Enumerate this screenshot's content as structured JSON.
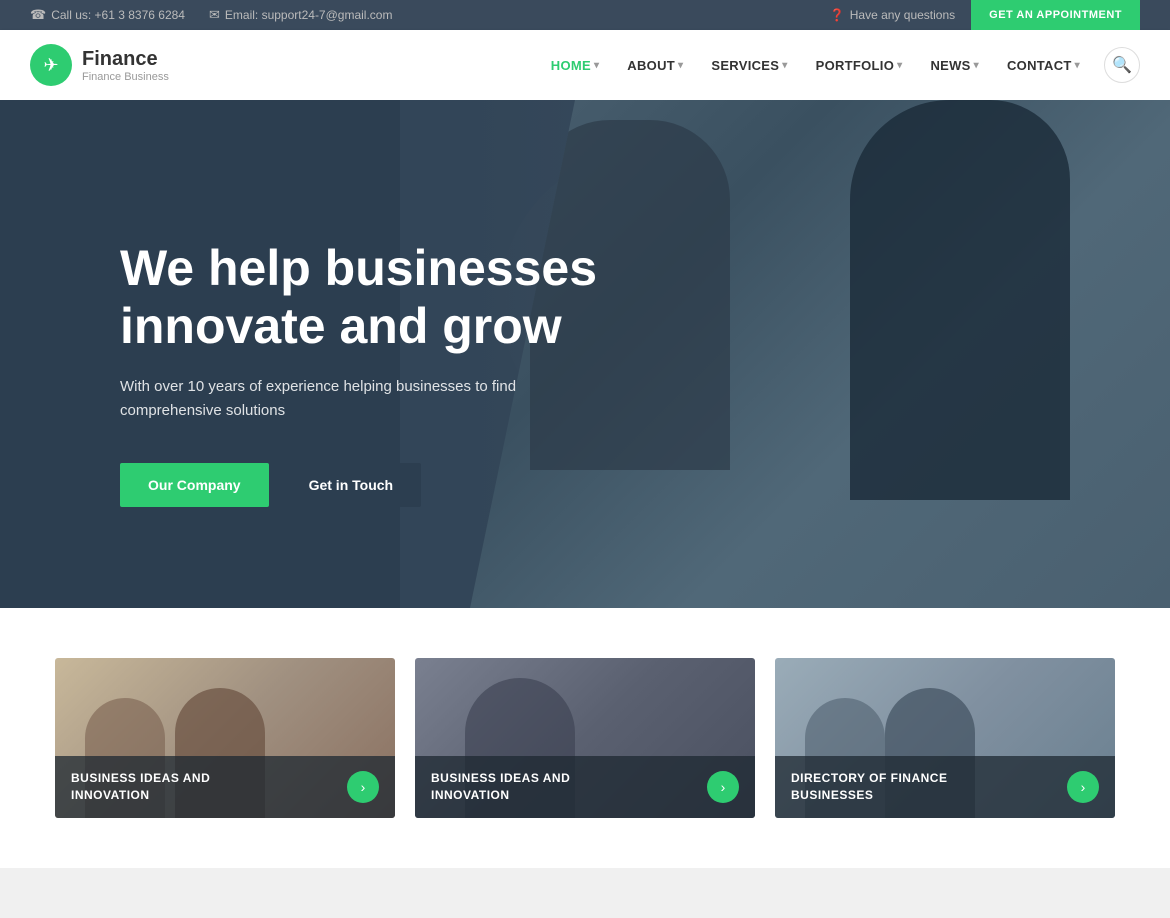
{
  "topbar": {
    "phone_icon": "☎",
    "phone_label": "Call us: +61 3 8376 6284",
    "email_icon": "✉",
    "email_label": "Email: support24-7@gmail.com",
    "question_icon": "?",
    "question_label": "Have any questions",
    "appointment_btn": "GET AN APPOINTMENT"
  },
  "header": {
    "logo_icon": "✈",
    "logo_title": "Finance",
    "logo_sub": "Finance Business",
    "nav": [
      {
        "label": "HOME",
        "has_dropdown": true,
        "active": true
      },
      {
        "label": "ABOUT",
        "has_dropdown": true,
        "active": false
      },
      {
        "label": "SERVICES",
        "has_dropdown": true,
        "active": false
      },
      {
        "label": "PORTFOLIO",
        "has_dropdown": true,
        "active": false
      },
      {
        "label": "NEWS",
        "has_dropdown": true,
        "active": false
      },
      {
        "label": "CONTACT",
        "has_dropdown": true,
        "active": false
      }
    ],
    "search_icon": "🔍"
  },
  "hero": {
    "title": "We help businesses innovate and grow",
    "subtitle": "With over 10 years of experience helping businesses to find comprehensive solutions",
    "btn_primary": "Our Company",
    "btn_secondary": "Get in Touch"
  },
  "cards": [
    {
      "label": "BUSINESS IDEAS AND INNOVATION",
      "arrow": "›"
    },
    {
      "label": "BUSINESS IDEAS AND INNOVATION",
      "arrow": "›"
    },
    {
      "label": "DIRECTORY OF FINANCE BUSINESSES",
      "arrow": "›"
    }
  ]
}
